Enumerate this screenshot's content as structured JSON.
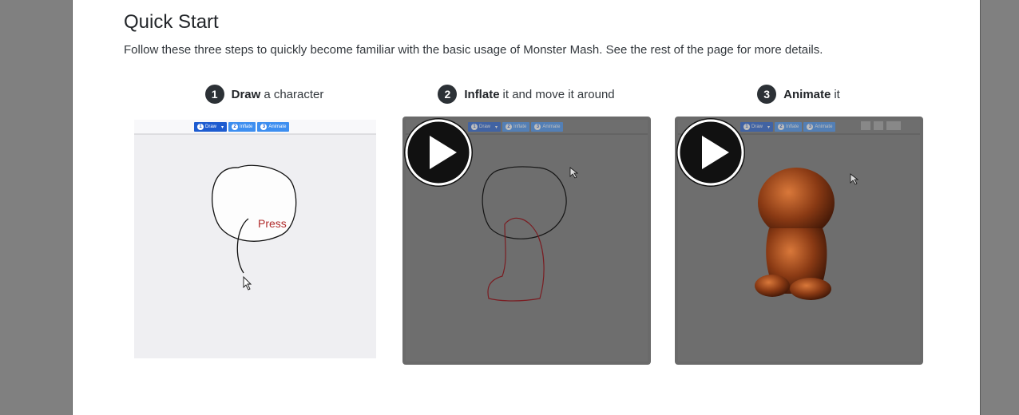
{
  "section": {
    "title": "Quick Start",
    "intro": "Follow these three steps to quickly become familiar with the basic usage of Monster Mash. See the rest of the page for more details."
  },
  "steps": [
    {
      "number": "1",
      "bold": "Draw",
      "rest": "a character"
    },
    {
      "number": "2",
      "bold": "Inflate",
      "rest": "it and move it around"
    },
    {
      "number": "3",
      "bold": "Animate",
      "rest": "it"
    }
  ],
  "mini_toolbar": {
    "draw": "Draw",
    "inflate": "Inflate",
    "animate": "Animate",
    "n1": "1",
    "n2": "2",
    "n3": "3"
  },
  "demo": {
    "press_label": "Press"
  },
  "colors": {
    "page_bg": "#ffffff",
    "outer_bg": "#808080",
    "badge": "#2c3136",
    "toolbar_blue": "#1d5bd0",
    "press_red": "#b02a2a"
  }
}
